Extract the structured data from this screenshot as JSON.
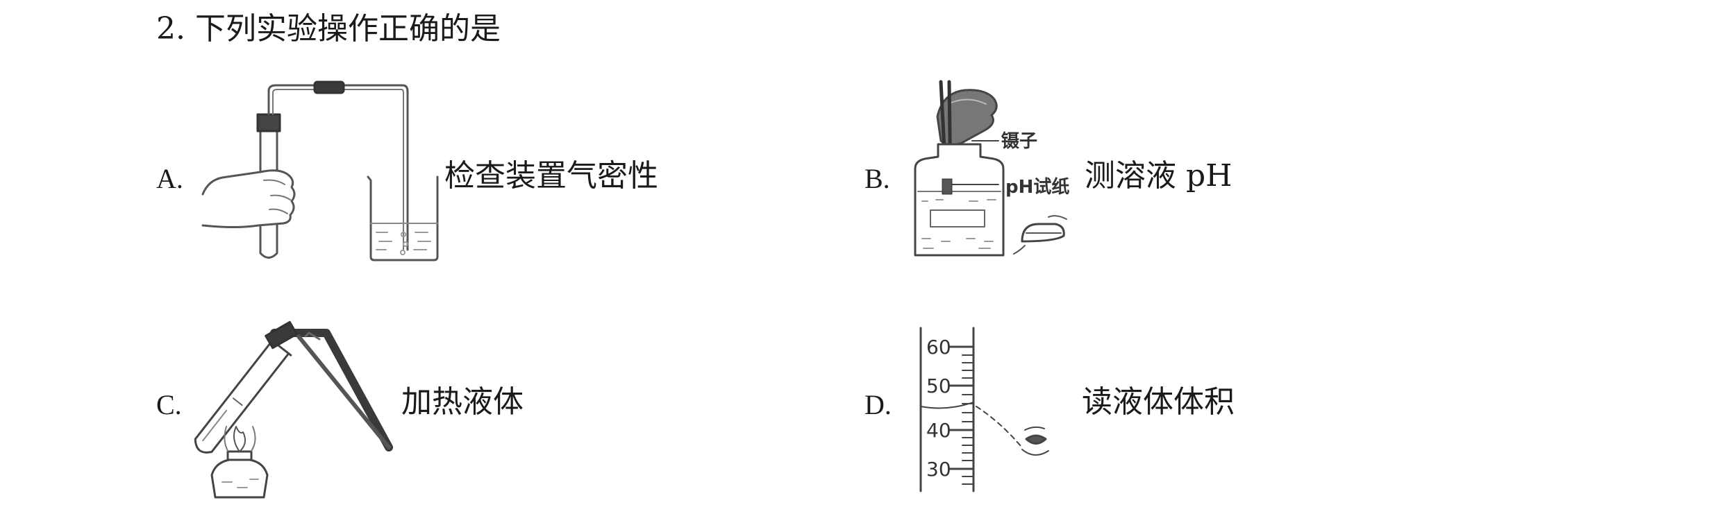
{
  "question": {
    "number": "2.",
    "text": "下列实验操作正确的是"
  },
  "options": [
    {
      "letter": "A.",
      "text": "检查装置气密性"
    },
    {
      "letter": "B.",
      "text": "测溶液 pH",
      "labels": [
        "镊子",
        "pH试纸"
      ]
    },
    {
      "letter": "C.",
      "text": "加热液体"
    },
    {
      "letter": "D.",
      "text": "读液体体积",
      "scale": [
        "60",
        "50",
        "40",
        "30"
      ]
    }
  ]
}
